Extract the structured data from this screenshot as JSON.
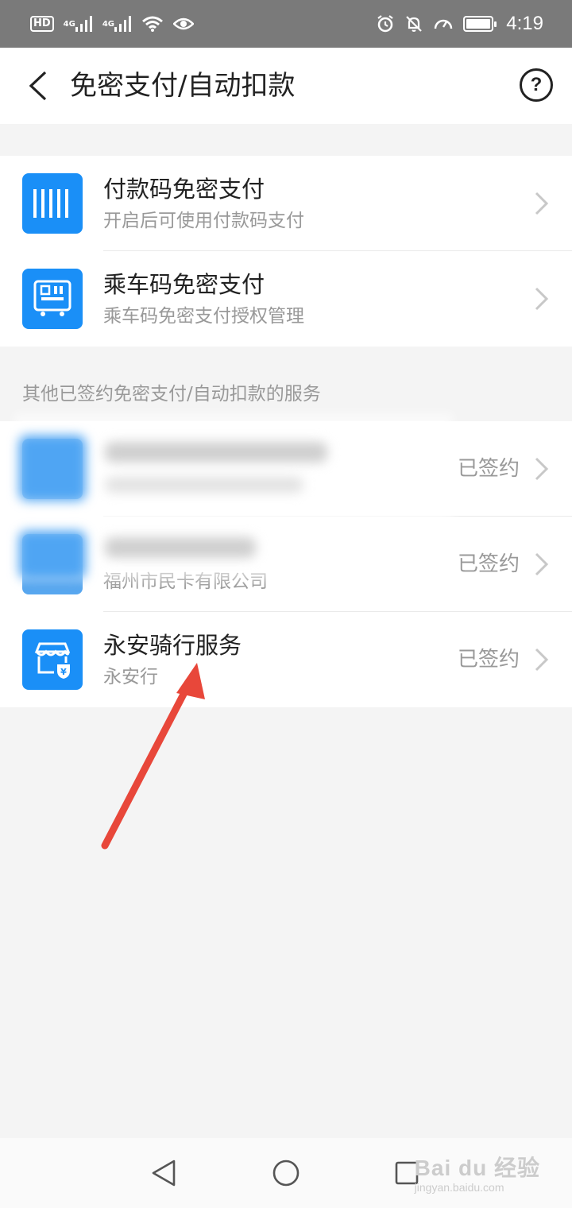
{
  "status_bar": {
    "left_icons": [
      "hd-icon",
      "signal-4g-icon",
      "signal-4g-icon",
      "wifi-icon",
      "eye-icon"
    ],
    "hd_label": "HD",
    "net_label_1": "4G",
    "net_label_2": "4G",
    "right_icons": [
      "alarm-icon",
      "bell-off-icon",
      "speed-icon",
      "battery-icon"
    ],
    "time": "4:19"
  },
  "header": {
    "title": "免密支付/自动扣款",
    "help_label": "?"
  },
  "section_1": {
    "items": [
      {
        "title": "付款码免密支付",
        "subtitle": "开启后可使用付款码支付",
        "icon": "barcode-icon"
      },
      {
        "title": "乘车码免密支付",
        "subtitle": "乘车码免密支付授权管理",
        "icon": "bus-qr-icon"
      }
    ]
  },
  "section_2": {
    "label": "其他已签约免密支付/自动扣款的服务",
    "items": [
      {
        "title": "",
        "subtitle": "",
        "status": "已签约",
        "icon": "app-icon"
      },
      {
        "title": "",
        "subtitle": "福州市民卡有限公司",
        "status": "已签约",
        "icon": "app-icon"
      },
      {
        "title": "永安骑行服务",
        "subtitle": "永安行",
        "status": "已签约",
        "icon": "bike-service-icon"
      }
    ]
  },
  "watermark": {
    "main": "Bai du 经验",
    "sub": "jingyan.baidu.com"
  },
  "colors": {
    "accent": "#1a8ff7",
    "annotation": "#e8473a",
    "status_bar": "#7a7a7a"
  }
}
